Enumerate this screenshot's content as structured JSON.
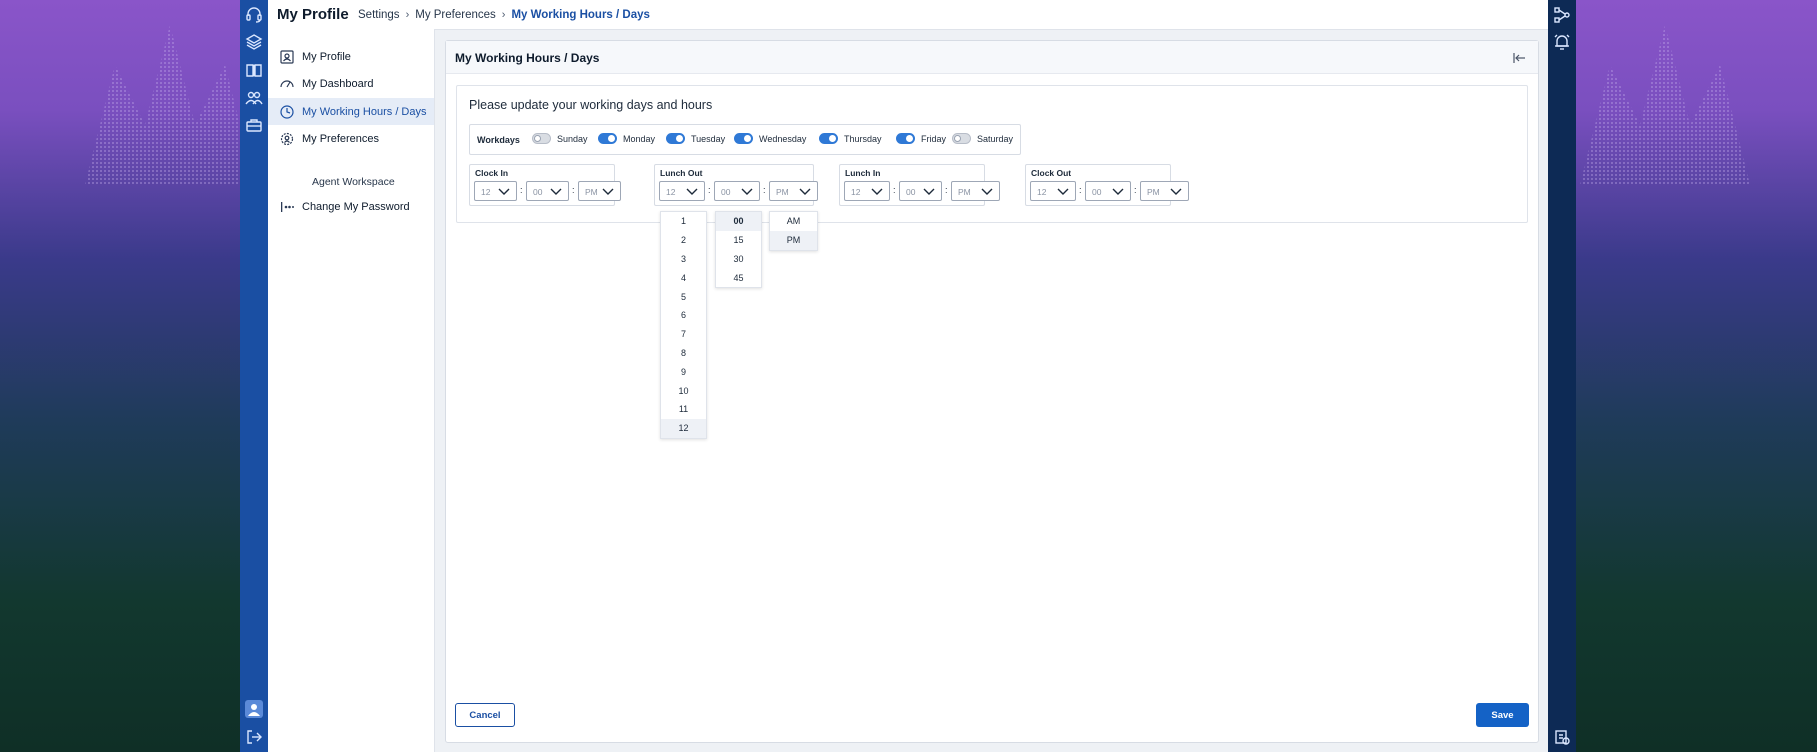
{
  "app": {
    "title": "My Profile"
  },
  "breadcrumb": {
    "items": [
      "Settings",
      "My Preferences"
    ],
    "current": "My Working Hours / Days"
  },
  "sidebar": {
    "items": [
      {
        "label": "My Profile",
        "icon": "user-card-icon"
      },
      {
        "label": "My Dashboard",
        "icon": "gauge-icon"
      },
      {
        "label": "My Working Hours / Days",
        "icon": "clock-icon",
        "active": true
      },
      {
        "label": "My Preferences",
        "icon": "gear-user-icon"
      },
      {
        "label": "Agent Workspace",
        "sub": true
      },
      {
        "label": "Change My Password",
        "icon": "password-icon"
      }
    ]
  },
  "panel": {
    "title": "My Working Hours / Days",
    "card_title": "Please update your working days and hours",
    "workdays_label": "Workdays",
    "days": [
      {
        "name": "Sunday",
        "on": false
      },
      {
        "name": "Monday",
        "on": true
      },
      {
        "name": "Tuesday",
        "on": true
      },
      {
        "name": "Wednesday",
        "on": true
      },
      {
        "name": "Thursday",
        "on": true
      },
      {
        "name": "Friday",
        "on": true
      },
      {
        "name": "Saturday",
        "on": false
      }
    ],
    "time_groups": [
      {
        "label": "Clock In",
        "hour": "12",
        "minute": "00",
        "ampm": "PM"
      },
      {
        "label": "Lunch Out",
        "hour": "12",
        "minute": "00",
        "ampm": "PM"
      },
      {
        "label": "Lunch In",
        "hour": "12",
        "minute": "00",
        "ampm": "PM"
      },
      {
        "label": "Clock Out",
        "hour": "12",
        "minute": "00",
        "ampm": "PM"
      }
    ],
    "colon": ":",
    "dropdowns": {
      "hours": [
        "1",
        "2",
        "3",
        "4",
        "5",
        "6",
        "7",
        "8",
        "9",
        "10",
        "11",
        "12"
      ],
      "minutes": [
        "00",
        "15",
        "30",
        "45"
      ],
      "ampm": [
        "AM",
        "PM"
      ]
    },
    "cancel_label": "Cancel",
    "save_label": "Save"
  },
  "colors": {
    "primary": "#1a4fa3",
    "toggle_on": "#2f79d6",
    "save": "#1462c6"
  }
}
